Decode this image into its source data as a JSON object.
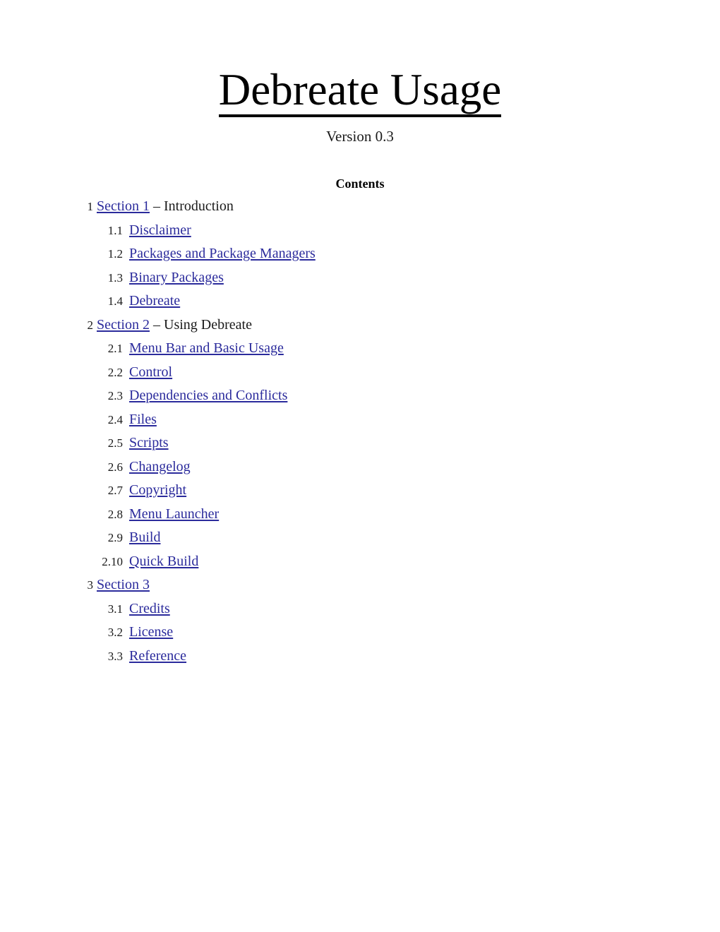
{
  "document": {
    "title": "Debreate Usage",
    "version": "Version 0.3",
    "contents_heading": "Contents"
  },
  "link_color": "#2b2b9c",
  "toc": {
    "entries": [
      {
        "level": 1,
        "number": "1",
        "link": "Section 1",
        "dash": "–",
        "description": "Introduction"
      },
      {
        "level": 2,
        "number": "1.1",
        "link": "Disclaimer",
        "dash": "",
        "description": ""
      },
      {
        "level": 2,
        "number": "1.2",
        "link": "Packages and Package Managers",
        "dash": "",
        "description": ""
      },
      {
        "level": 2,
        "number": "1.3",
        "link": "Binary Packages",
        "dash": "",
        "description": ""
      },
      {
        "level": 2,
        "number": "1.4",
        "link": "Debreate",
        "dash": "",
        "description": ""
      },
      {
        "level": 1,
        "number": "2",
        "link": "Section 2",
        "dash": "–",
        "description": "Using Debreate"
      },
      {
        "level": 2,
        "number": "2.1",
        "link": "Menu Bar and Basic Usage",
        "dash": "",
        "description": ""
      },
      {
        "level": 2,
        "number": "2.2",
        "link": "Control",
        "dash": "",
        "description": ""
      },
      {
        "level": 2,
        "number": "2.3",
        "link": "Dependencies and Conflicts",
        "dash": "",
        "description": ""
      },
      {
        "level": 2,
        "number": "2.4",
        "link": "Files",
        "dash": "",
        "description": ""
      },
      {
        "level": 2,
        "number": "2.5",
        "link": "Scripts",
        "dash": "",
        "description": ""
      },
      {
        "level": 2,
        "number": "2.6",
        "link": "Changelog",
        "dash": "",
        "description": ""
      },
      {
        "level": 2,
        "number": "2.7",
        "link": "Copyright",
        "dash": "",
        "description": ""
      },
      {
        "level": 2,
        "number": "2.8",
        "link": "Menu Launcher",
        "dash": "",
        "description": ""
      },
      {
        "level": 2,
        "number": "2.9",
        "link": "Build",
        "dash": "",
        "description": ""
      },
      {
        "level": 2,
        "number": "2.10",
        "link": "Quick Build",
        "dash": "",
        "description": ""
      },
      {
        "level": 1,
        "number": "3",
        "link": "Section 3",
        "dash": "",
        "description": ""
      },
      {
        "level": 2,
        "number": "3.1",
        "link": "Credits",
        "dash": "",
        "description": ""
      },
      {
        "level": 2,
        "number": "3.2",
        "link": "License",
        "dash": "",
        "description": ""
      },
      {
        "level": 2,
        "number": "3.3",
        "link": "Reference",
        "dash": "",
        "description": ""
      }
    ]
  }
}
